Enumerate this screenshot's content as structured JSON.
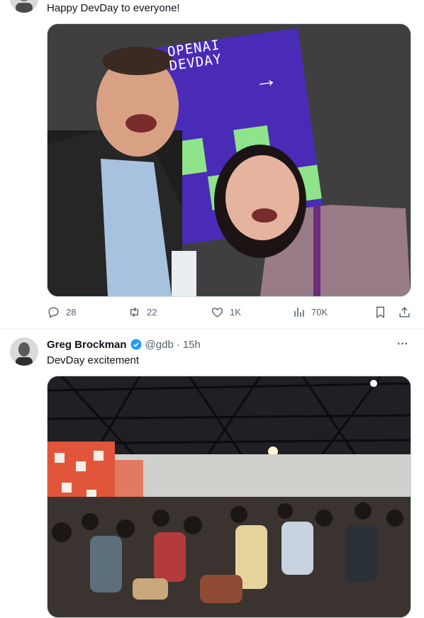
{
  "tweet1": {
    "text": "Happy DevDay to everyone!",
    "photo_sign": "OPENAI DEVDAY",
    "photo_arrow": "→",
    "actions": {
      "replies": "28",
      "retweets": "22",
      "likes": "1K",
      "views": "70K"
    }
  },
  "tweet2": {
    "author_name": "Greg Brockman",
    "handle": "@gdb",
    "dot": "·",
    "time": "15h",
    "more": "···",
    "text": "DevDay excitement"
  },
  "colors": {
    "accent": "#1d9bf0",
    "muted": "#536471",
    "sign_purple": "#4a2bb8",
    "sign_green": "#8fe38a"
  },
  "icons": [
    "reply-icon",
    "retweet-icon",
    "like-icon",
    "views-icon",
    "bookmark-icon",
    "share-icon",
    "verified-icon",
    "more-icon"
  ]
}
